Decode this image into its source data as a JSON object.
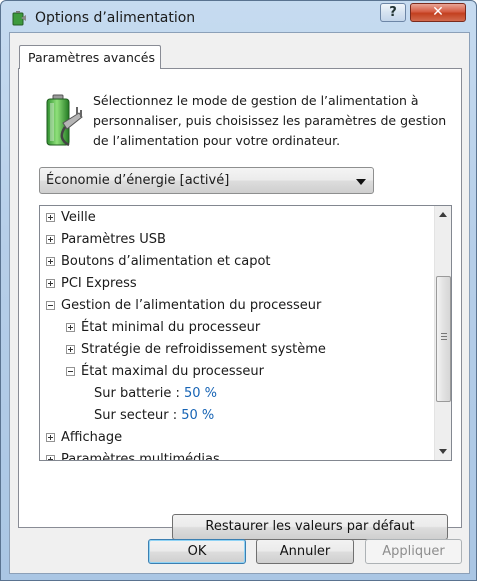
{
  "window": {
    "title": "Options d’alimentation",
    "help_label": "?",
    "close_label": "✕"
  },
  "tab": {
    "label": "Paramètres avancés"
  },
  "description": "Sélectionnez le mode de gestion de l’alimentation à personnaliser, puis choisissez les paramètres de gestion de l’alimentation pour votre ordinateur.",
  "plan_select": {
    "value": "Économie d’énergie [activé]"
  },
  "tree": {
    "items": [
      {
        "label": "Veille",
        "level": 0,
        "state": "collapsed"
      },
      {
        "label": "Paramètres USB",
        "level": 0,
        "state": "collapsed"
      },
      {
        "label": "Boutons d’alimentation et capot",
        "level": 0,
        "state": "collapsed"
      },
      {
        "label": "PCI Express",
        "level": 0,
        "state": "collapsed"
      },
      {
        "label": "Gestion de l’alimentation du processeur",
        "level": 0,
        "state": "expanded"
      },
      {
        "label": "État minimal du processeur",
        "level": 1,
        "state": "collapsed"
      },
      {
        "label": "Stratégie de refroidissement système",
        "level": 1,
        "state": "collapsed"
      },
      {
        "label": "État maximal du processeur",
        "level": 1,
        "state": "expanded"
      },
      {
        "label": "Sur batterie :",
        "value": "50  %",
        "level": 2,
        "state": "leaf"
      },
      {
        "label": "Sur secteur :",
        "value": "50  %",
        "level": 2,
        "state": "leaf"
      },
      {
        "label": "Affichage",
        "level": 0,
        "state": "collapsed"
      },
      {
        "label": "Paramètres multimédias",
        "level": 0,
        "state": "collapsed"
      }
    ]
  },
  "buttons": {
    "restore": "Restaurer les valeurs par défaut",
    "ok": "OK",
    "cancel": "Annuler",
    "apply": "Appliquer"
  },
  "colors": {
    "value_text": "#1764b5",
    "close_button": "#c3401f",
    "titlebar": "#b7cfe9"
  }
}
